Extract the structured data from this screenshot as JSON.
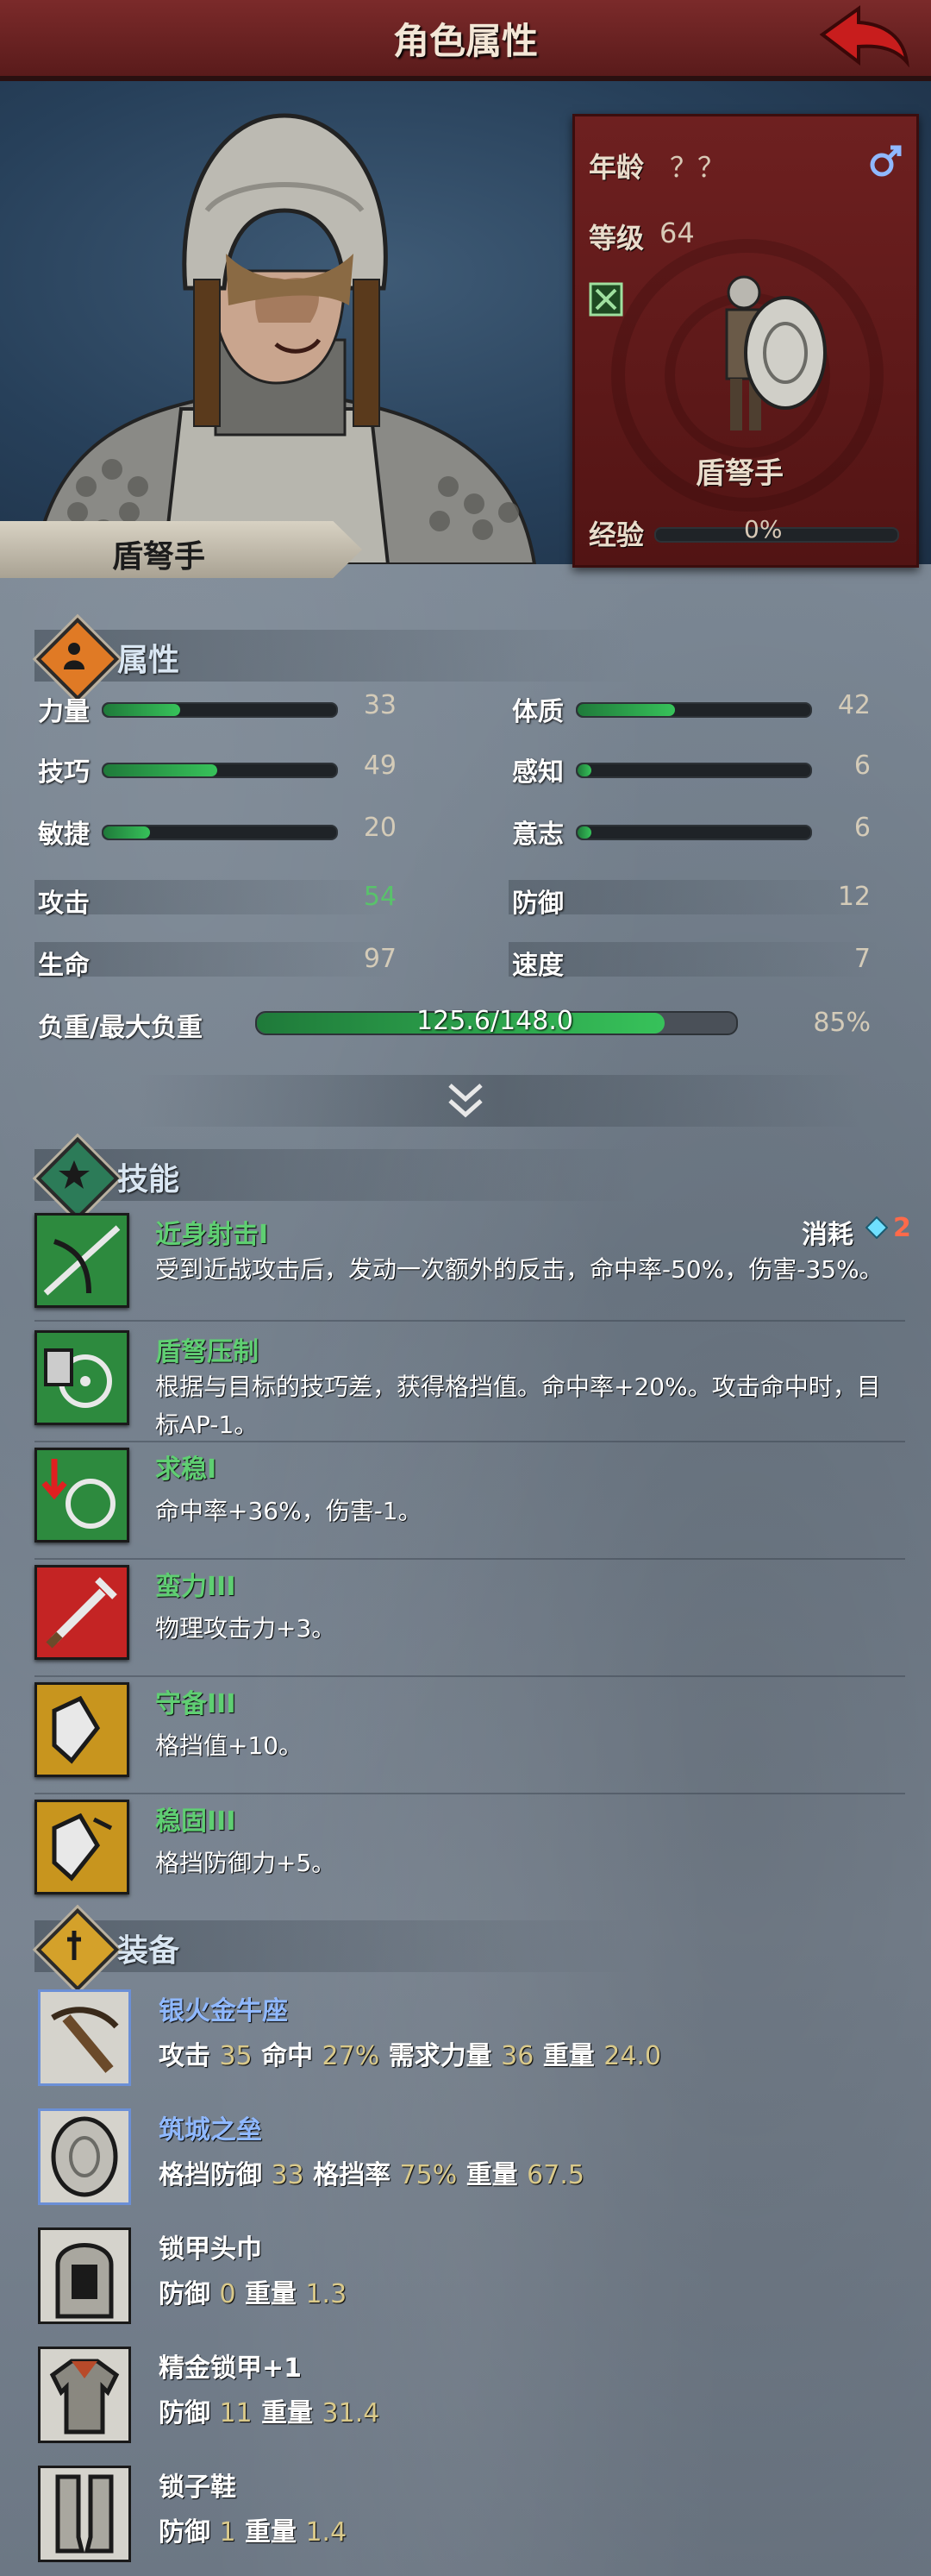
{
  "header": {
    "title": "角色属性",
    "back_icon": "back-arrow-icon"
  },
  "character": {
    "name": "盾弩手",
    "age_label": "年龄",
    "age_value": "？？",
    "gender_icon": "male-icon",
    "level_label": "等级",
    "level_value": "64",
    "unit_name": "盾弩手",
    "exp_label": "经验",
    "exp_value": "0%",
    "exp_fraction": 0.0
  },
  "attributes": {
    "title": "属性",
    "left": [
      {
        "label": "力量",
        "value": "33",
        "fill": 0.33
      },
      {
        "label": "技巧",
        "value": "49",
        "fill": 0.49
      },
      {
        "label": "敏捷",
        "value": "20",
        "fill": 0.2
      }
    ],
    "right": [
      {
        "label": "体质",
        "value": "42",
        "fill": 0.42
      },
      {
        "label": "感知",
        "value": "6",
        "fill": 0.06
      },
      {
        "label": "意志",
        "value": "6",
        "fill": 0.06
      }
    ],
    "combat_left": [
      {
        "label": "攻击",
        "value": "54"
      },
      {
        "label": "生命",
        "value": "97"
      }
    ],
    "combat_right": [
      {
        "label": "防御",
        "value": "12"
      },
      {
        "label": "速度",
        "value": "7"
      }
    ],
    "load_label": "负重/最大负重",
    "load_value": "125.6/148.0",
    "load_percent": "85%",
    "load_fraction": 0.85
  },
  "skills": {
    "title": "技能",
    "cost_label": "消耗",
    "cost_value": "2",
    "items": [
      {
        "name": "近身射击I",
        "desc1": "受到近战攻击后，发动一次额外的反击，命中率-50%，伤害-35%。",
        "desc2": ""
      },
      {
        "name": "盾弩压制",
        "desc1": "根据与目标的技巧差，获得格挡值。命中率+20%。攻击命中时，目",
        "desc2": "标AP-1。"
      },
      {
        "name": "求稳I",
        "desc1": "命中率+36%，伤害-1。",
        "desc2": ""
      },
      {
        "name": "蛮力III",
        "desc1": "物理攻击力+3。",
        "desc2": ""
      },
      {
        "name": "守备III",
        "desc1": "格挡值+10。",
        "desc2": ""
      },
      {
        "name": "稳固III",
        "desc1": "格挡防御力+5。",
        "desc2": ""
      }
    ]
  },
  "equipment": {
    "title": "装备",
    "items": [
      {
        "name": "银火金牛座",
        "color": "#8fb8ff",
        "stats": [
          [
            "攻击",
            "35"
          ],
          [
            "命中",
            "27%"
          ],
          [
            "需求力量",
            "36"
          ],
          [
            "重量",
            "24.0"
          ]
        ]
      },
      {
        "name": "筑城之垒",
        "color": "#8fb8ff",
        "stats": [
          [
            "格挡防御",
            "33"
          ],
          [
            "格挡率",
            "75%"
          ],
          [
            "重量",
            "67.5"
          ]
        ]
      },
      {
        "name": "锁甲头巾",
        "color": "#ffffff",
        "stats": [
          [
            "防御",
            "0"
          ],
          [
            "重量",
            "1.3"
          ]
        ]
      },
      {
        "name": "精金锁甲+1",
        "color": "#ffffff",
        "stats": [
          [
            "防御",
            "11"
          ],
          [
            "重量",
            "31.4"
          ]
        ]
      },
      {
        "name": "锁子鞋",
        "color": "#ffffff",
        "stats": [
          [
            "防御",
            "1"
          ],
          [
            "重量",
            "1.4"
          ]
        ]
      }
    ]
  }
}
